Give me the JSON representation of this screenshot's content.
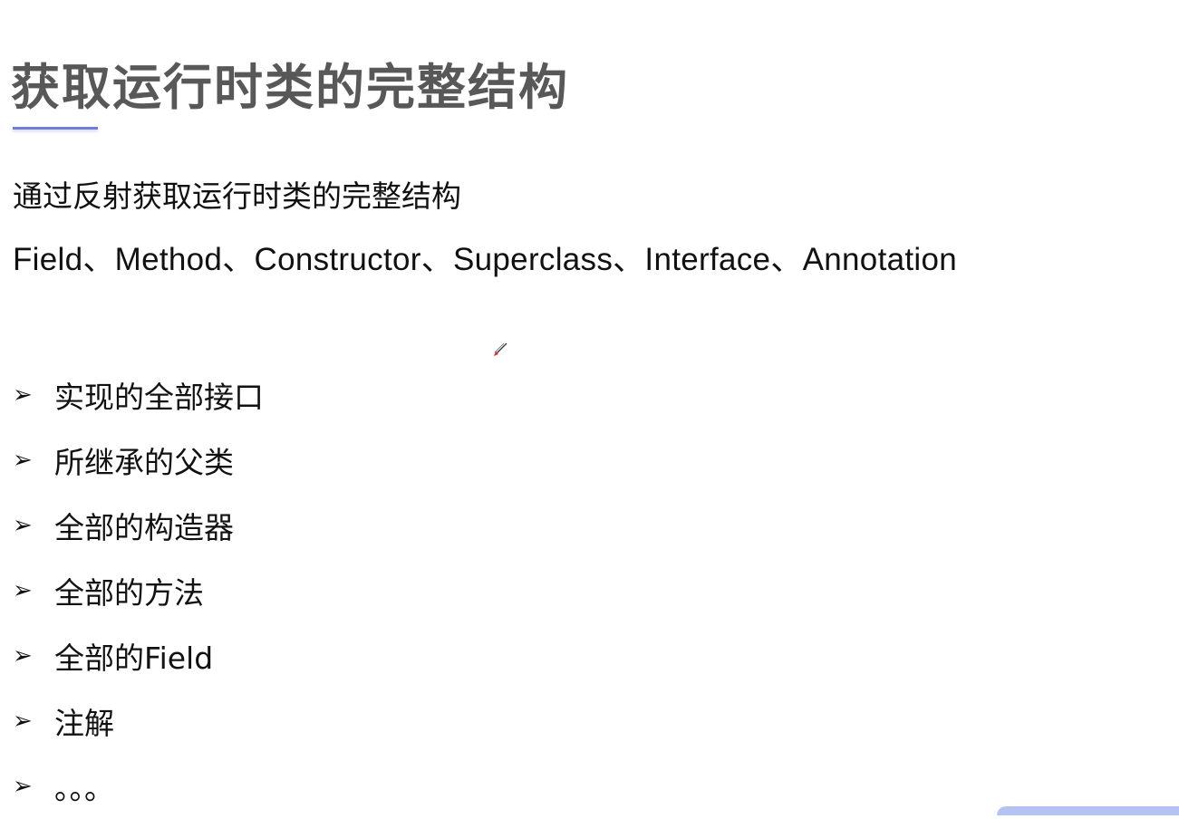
{
  "slide": {
    "title": "获取运行时类的完整结构",
    "subtitle": "通过反射获取运行时类的完整结构",
    "subtitle_en": "Field、Method、Constructor、Superclass、Interface、Annotation",
    "bullet_glyph": "➢",
    "bullets": [
      "实现的全部接口",
      "所继承的父类",
      "全部的构造器",
      "全部的方法",
      "全部的Field",
      "注解",
      "。。。"
    ]
  },
  "colors": {
    "title": "#585858",
    "underline": "#6f7fd6",
    "accent": "#b6c3f2",
    "pen": "#e03030"
  },
  "icons": {
    "cursor": "pen-cursor-icon"
  }
}
